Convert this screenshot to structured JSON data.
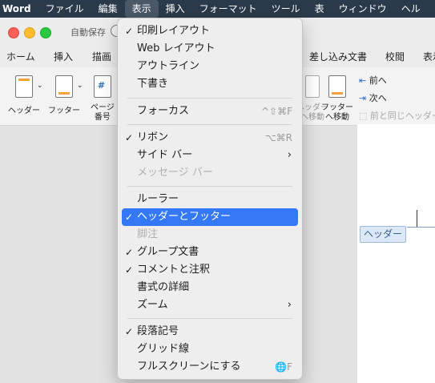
{
  "menubar": [
    "Word",
    "ファイル",
    "編集",
    "表示",
    "挿入",
    "フォーマット",
    "ツール",
    "表",
    "ウィンドウ",
    "ヘル"
  ],
  "titlebar": {
    "autosave": "自動保存"
  },
  "ribbon_tabs": [
    "ホーム",
    "挿入",
    "描画",
    "差し込み文書",
    "校閲",
    "表示"
  ],
  "ribbon": {
    "header": "ヘッダー",
    "footer": "フッター",
    "page_num_1": "ページ",
    "page_num_2": "番号",
    "goto_header_1": "ヘッダー",
    "goto_header_2": "へ移動",
    "goto_footer_1": "フッター",
    "goto_footer_2": "へ移動",
    "prev": "前へ",
    "next": "次へ",
    "same_as_prev": "前と同じヘッダー"
  },
  "document": {
    "header_tag": "ヘッダー"
  },
  "view_menu": {
    "print_layout": "印刷レイアウト",
    "web_layout": "Web レイアウト",
    "outline": "アウトライン",
    "draft": "下書き",
    "focus": "フォーカス",
    "focus_shortcut": "^⇧⌘F",
    "ribbon": "リボン",
    "ribbon_shortcut": "⌥⌘R",
    "sidebar": "サイド バー",
    "message_bar": "メッセージ バー",
    "ruler": "ルーラー",
    "header_footer": "ヘッダーとフッター",
    "footnotes": "脚注",
    "master_document": "グループ文書",
    "comments": "コメントと注釈",
    "reveal_formatting": "書式の詳細",
    "zoom": "ズーム",
    "paragraph_marks": "段落記号",
    "gridlines": "グリッド線",
    "full_screen": "フルスクリーンにする",
    "full_screen_shortcut": "🌐F",
    "check": "✓",
    "arrow": "›"
  }
}
